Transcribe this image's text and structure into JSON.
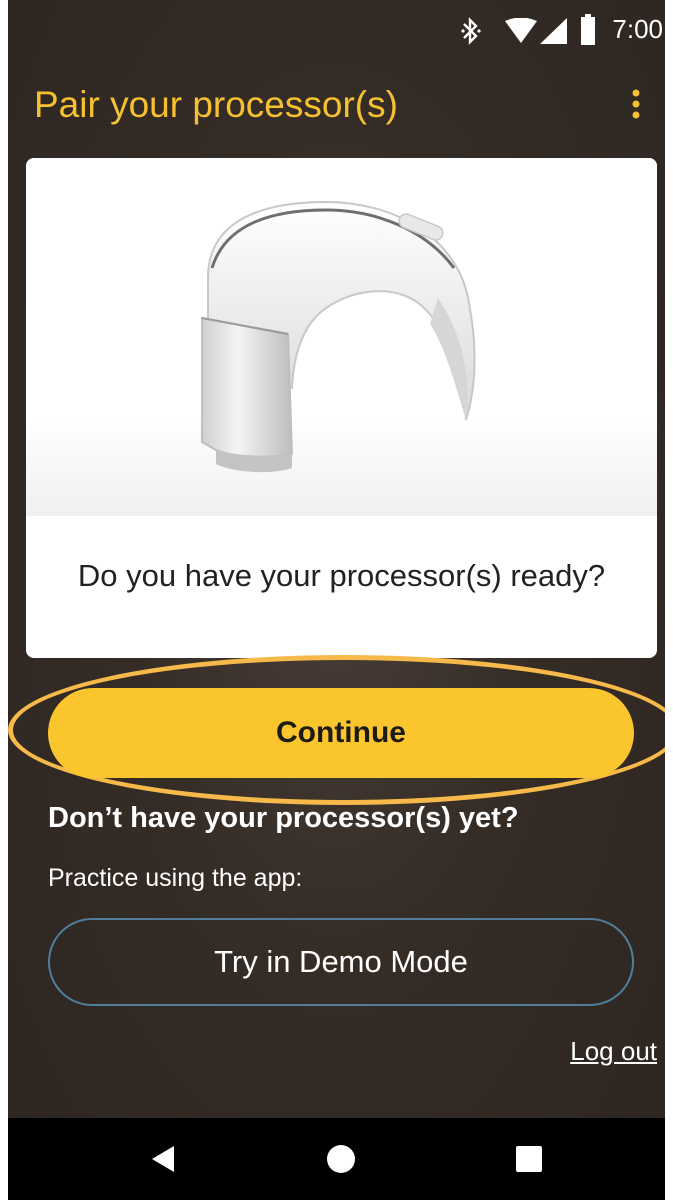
{
  "status_bar": {
    "time": "7:00",
    "icons": [
      "bluetooth-icon",
      "wifi-icon",
      "cellular-signal-icon",
      "battery-icon"
    ]
  },
  "app_bar": {
    "title": "Pair your processor(s)",
    "menu_icon": "more-vertical-icon"
  },
  "card": {
    "image": "sound-processor-illustration",
    "prompt": "Do you have your processor(s) ready?"
  },
  "actions": {
    "continue_label": "Continue",
    "no_processor_heading": "Don’t have your processor(s) yet?",
    "practice_label": "Practice using the app:",
    "demo_label": "Try in Demo Mode",
    "logout_label": "Log out"
  },
  "nav_bar": {
    "icons": [
      "back-icon",
      "home-icon",
      "recents-icon"
    ]
  },
  "colors": {
    "accent": "#f5c131",
    "button_fill": "#fbc52d",
    "highlight_ring": "#f6b94a",
    "background": "#352c26",
    "demo_border": "#4f7f9c"
  }
}
